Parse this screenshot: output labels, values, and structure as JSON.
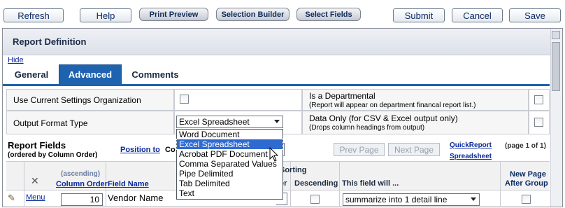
{
  "toolbar": {
    "refresh": "Refresh",
    "help": "Help",
    "print_preview": "Print Preview",
    "selection_builder": "Selection Builder",
    "select_fields": "Select Fields",
    "submit": "Submit",
    "cancel": "Cancel",
    "save": "Save"
  },
  "panel": {
    "title": "Report Definition",
    "hide_link": "Hide"
  },
  "tabs": [
    {
      "label": "General",
      "active": false
    },
    {
      "label": "Advanced",
      "active": true
    },
    {
      "label": "Comments",
      "active": false
    }
  ],
  "settings": {
    "use_current_org_label": "Use Current Settings Organization",
    "output_format_label": "Output Format Type",
    "output_format_value": "Excel Spreadsheet",
    "departmental_label": "Is a Departmental",
    "departmental_note": "(Report will appear on department financal report list.)",
    "data_only_label": "Data Only (for CSV & Excel output only)",
    "data_only_note": "(Drops column headings from output)"
  },
  "format_options": [
    {
      "label": "Word Document",
      "selected": false
    },
    {
      "label": "Excel Spreadsheet",
      "selected": true
    },
    {
      "label": "Acrobat PDF Document",
      "selected": false
    },
    {
      "label": "Comma Separated Values",
      "selected": false
    },
    {
      "label": "Pipe Delimited",
      "selected": false
    },
    {
      "label": "Tab Delimited",
      "selected": false
    },
    {
      "label": "Text",
      "selected": false
    }
  ],
  "report_fields": {
    "title": "Report Fields",
    "subtitle": "(ordered by Column Order)",
    "position_link": "Position to",
    "position_trailing": "Co",
    "prev_page": "Prev Page",
    "next_page": "Next Page",
    "quick_report": "QuickReport",
    "spreadsheet": "Spreadsheet",
    "page_info": "(page 1 of 1)"
  },
  "grid": {
    "ascending": "(ascending)",
    "column_order": "Column Order",
    "field_name": "Field Name",
    "sorting": "Sorting",
    "order_partial": "er",
    "descending": "Descending",
    "this_field_will": "This field will ...",
    "new_page": "New Page",
    "after_group": "After Group",
    "row": {
      "menu": "Menu",
      "order": "10",
      "field": "Vendor Name",
      "action": "summarize into 1 detail line"
    }
  },
  "colors": {
    "active_tab": "#1e63b0",
    "link": "#0a2a9c",
    "selected_option": "#2f6ad0"
  }
}
